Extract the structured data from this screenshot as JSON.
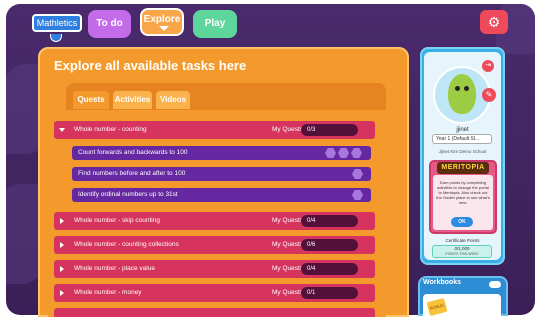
{
  "nav": {
    "logo": "Mathletics",
    "todo": "To do",
    "explore": "Explore",
    "play": "Play"
  },
  "main": {
    "title": "Explore all available tasks here",
    "tabs": [
      "Quests",
      "Activities",
      "Videos"
    ]
  },
  "quests": [
    {
      "name": "Whole number - counting",
      "my_quests_label": "My Quests",
      "progress": "0/3",
      "expanded": true
    },
    {
      "name": "Whole number - skip counting",
      "my_quests_label": "My Quests",
      "progress": "0/4",
      "expanded": false
    },
    {
      "name": "Whole number - counting collections",
      "my_quests_label": "My Quests",
      "progress": "0/6",
      "expanded": false
    },
    {
      "name": "Whole number - place value",
      "my_quests_label": "My Quests",
      "progress": "0/4",
      "expanded": false
    },
    {
      "name": "Whole number - money",
      "my_quests_label": "My Quests",
      "progress": "0/1",
      "expanded": false
    }
  ],
  "subtasks": [
    {
      "name": "Count forwards and backwards to 100",
      "hexes": 3
    },
    {
      "name": "Find numbers before and after to 100",
      "hexes": 1
    },
    {
      "name": "Identify ordinal numbers up to 31st",
      "hexes": 1
    }
  ],
  "profile": {
    "username": "jjinet",
    "year": "Year 1 (Default Sl...",
    "school": "Jjinet Kim Demo School",
    "meritopia_logo": "MERITOPIA",
    "meritopia_text": "Earn points by completing activities to change the portal to Meritopia. Also check out the Oodlet place to see what's new.",
    "ok": "OK",
    "certificate_label": "Certificate Points",
    "certificate_points": "0/1,000",
    "certificate_sub": "POINTS THIS WEEK"
  },
  "workbooks": {
    "title": "Workbooks",
    "badge": "BONUS"
  },
  "colors": {
    "background": "#4a2a6c",
    "main_panel": "#f49a2c",
    "quest_row": "#d6335f",
    "subtask_row": "#6528a0",
    "sidebar": "#3ab0e6"
  }
}
